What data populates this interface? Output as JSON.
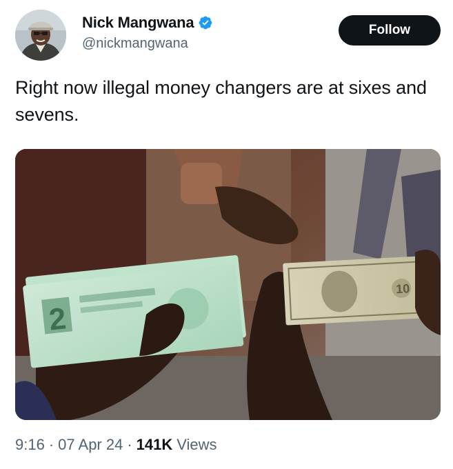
{
  "author": {
    "display_name": "Nick Mangwana",
    "handle": "@nickmangwana",
    "verified": true,
    "verified_badge_color": "#1d9bf0"
  },
  "actions": {
    "follow_label": "Follow"
  },
  "tweet": {
    "text": "Right now illegal money changers are at sixes and sevens."
  },
  "media": {
    "icon": "photo-money-exchange"
  },
  "meta": {
    "time": "9:16",
    "separator": "·",
    "date": "07 Apr 24",
    "views_count": "141K",
    "views_label": "Views"
  },
  "colors": {
    "text_primary": "#0f1419",
    "text_secondary": "#536471",
    "button_bg": "#0f1419",
    "button_text": "#ffffff"
  }
}
